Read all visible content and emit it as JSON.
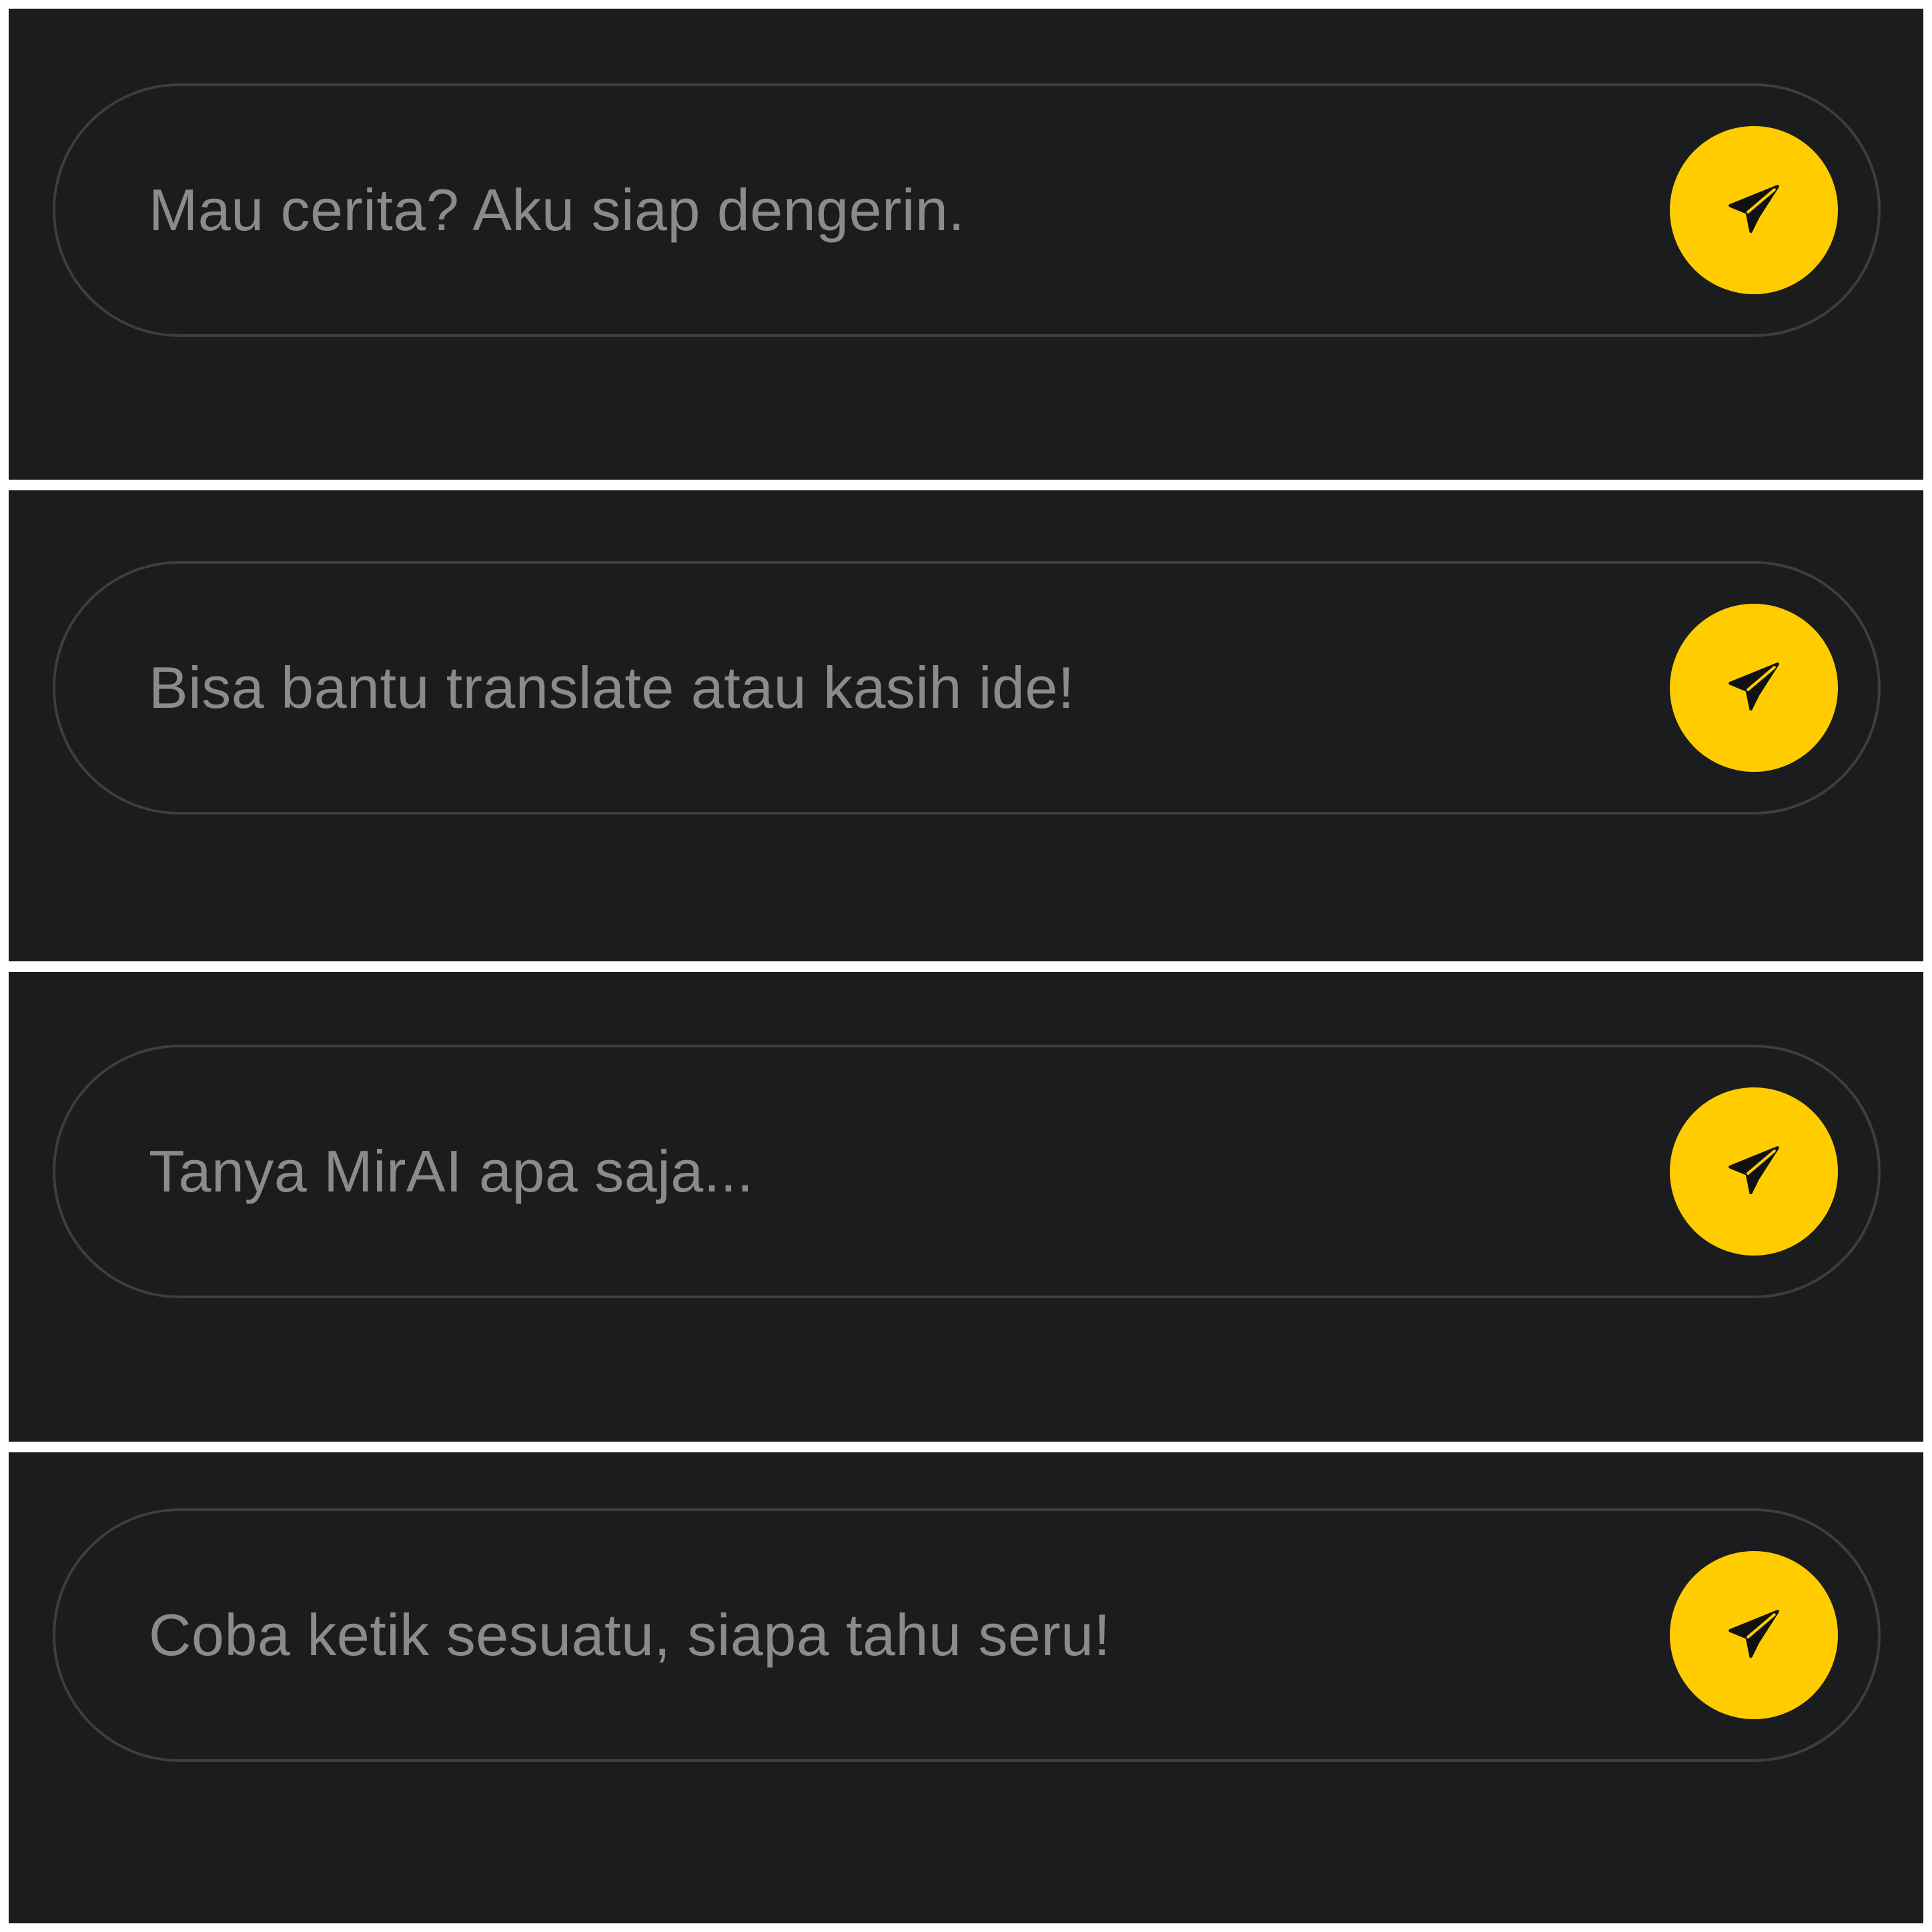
{
  "colors": {
    "background": "#1b1c1e",
    "border": "#3d3e41",
    "placeholder_text": "#8a8b8d",
    "send_button": "#ffcc00",
    "send_icon": "#111111"
  },
  "inputs": [
    {
      "placeholder": "Mau cerita? Aku siap dengerin.",
      "send_icon": "send-icon"
    },
    {
      "placeholder": "Bisa bantu translate atau kasih ide!",
      "send_icon": "send-icon"
    },
    {
      "placeholder": "Tanya MirAI apa saja...",
      "send_icon": "send-icon"
    },
    {
      "placeholder": "Coba ketik sesuatu, siapa tahu seru!",
      "send_icon": "send-icon"
    }
  ]
}
